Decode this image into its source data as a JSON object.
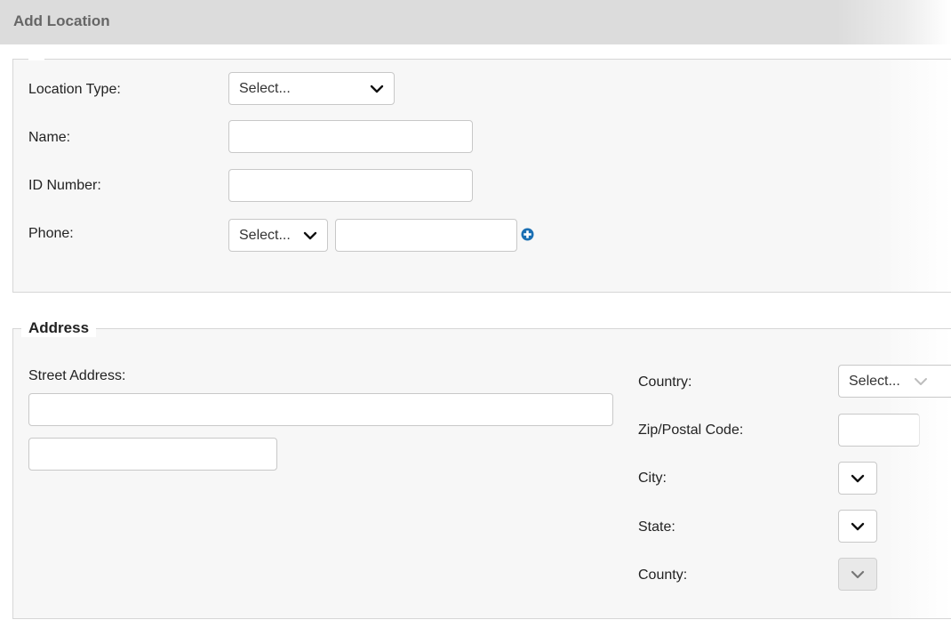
{
  "header": {
    "title": "Add Location"
  },
  "location": {
    "type_label": "Location Type:",
    "type_value": "Select...",
    "name_label": "Name:",
    "name_value": "",
    "id_label": "ID Number:",
    "id_value": "",
    "phone_label": "Phone:",
    "phone_type_value": "Select...",
    "phone_value": ""
  },
  "address": {
    "legend": "Address",
    "street_label": "Street Address:",
    "street1_value": "",
    "street2_value": "",
    "country_label": "Country:",
    "country_value": "Select...",
    "zip_label": "Zip/Postal Code:",
    "zip_value": "",
    "city_label": "City:",
    "state_label": "State:",
    "county_label": "County:"
  },
  "icons": {
    "chevron": "chevron-down-icon",
    "add_phone": "plus-circle-icon"
  },
  "colors": {
    "header_bg": "#dcdcdc",
    "panel_bg": "#f7f7f7",
    "accent_blue": "#1a6fb3"
  }
}
